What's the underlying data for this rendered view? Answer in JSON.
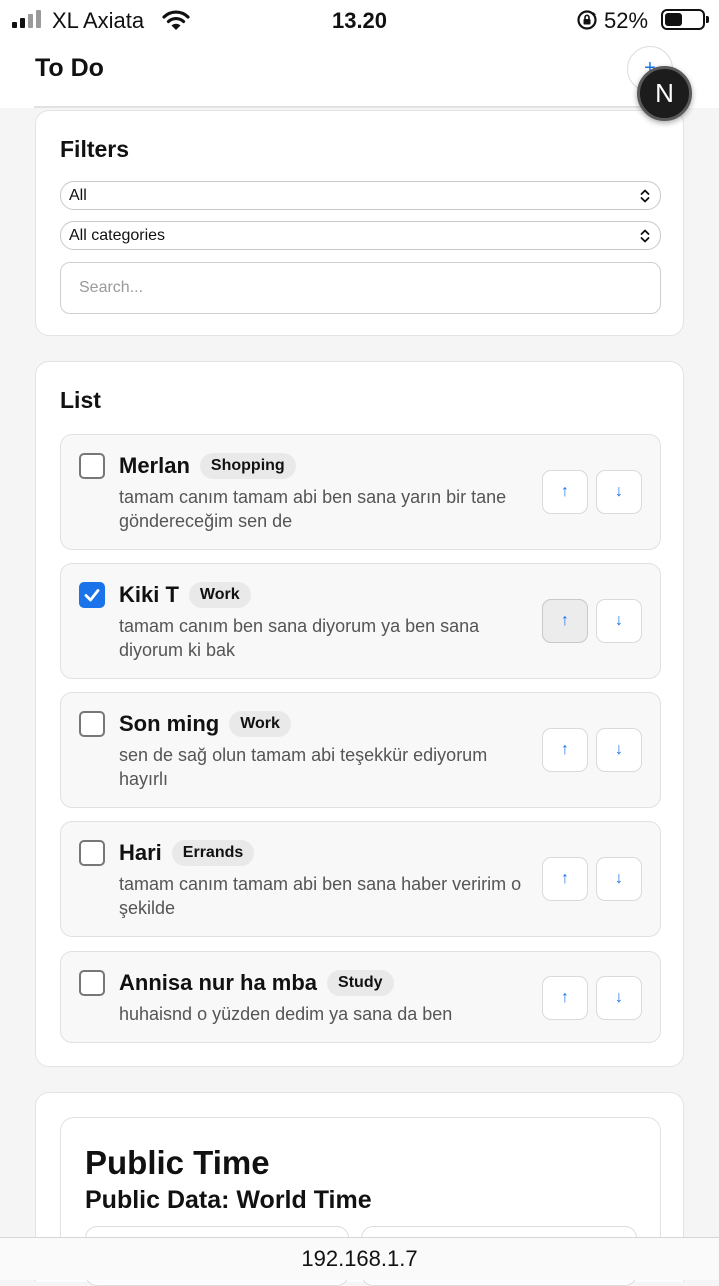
{
  "status_bar": {
    "carrier": "XL Axiata",
    "time": "13.20",
    "battery_percent": "52%",
    "battery_level": 0.52
  },
  "header": {
    "title": "To Do",
    "add_label": "+",
    "next_badge_label": "N"
  },
  "filters": {
    "title": "Filters",
    "status_select": "All",
    "category_select": "All categories",
    "search_placeholder": "Search..."
  },
  "list": {
    "title": "List",
    "up_label": "↑",
    "down_label": "↓",
    "items": [
      {
        "name": "Merlan",
        "tag": "Shopping",
        "desc": "tamam canım tamam abi ben sana yarın bir tane göndereceğim sen de",
        "checked": false
      },
      {
        "name": "Kiki T",
        "tag": "Work",
        "desc": "tamam canım ben sana diyorum ya ben sana diyorum ki bak",
        "checked": true
      },
      {
        "name": "Son ming",
        "tag": "Work",
        "desc": "sen de sağ olun tamam abi teşekkür ediyorum hayırlı",
        "checked": false
      },
      {
        "name": "Hari",
        "tag": "Errands",
        "desc": "tamam canım tamam abi ben sana haber veririm o şekilde",
        "checked": false
      },
      {
        "name": "Annisa nur ha mba",
        "tag": "Study",
        "desc": "huhaisnd o yüzden dedim ya sana da ben",
        "checked": false
      }
    ]
  },
  "public_time": {
    "title": "Public Time",
    "subtitle": "Public Data: World Time"
  },
  "browser": {
    "url": "192.168.1.7"
  },
  "colors": {
    "accent": "#1a73e8",
    "background": "#f5f5f5",
    "card": "#ffffff"
  }
}
